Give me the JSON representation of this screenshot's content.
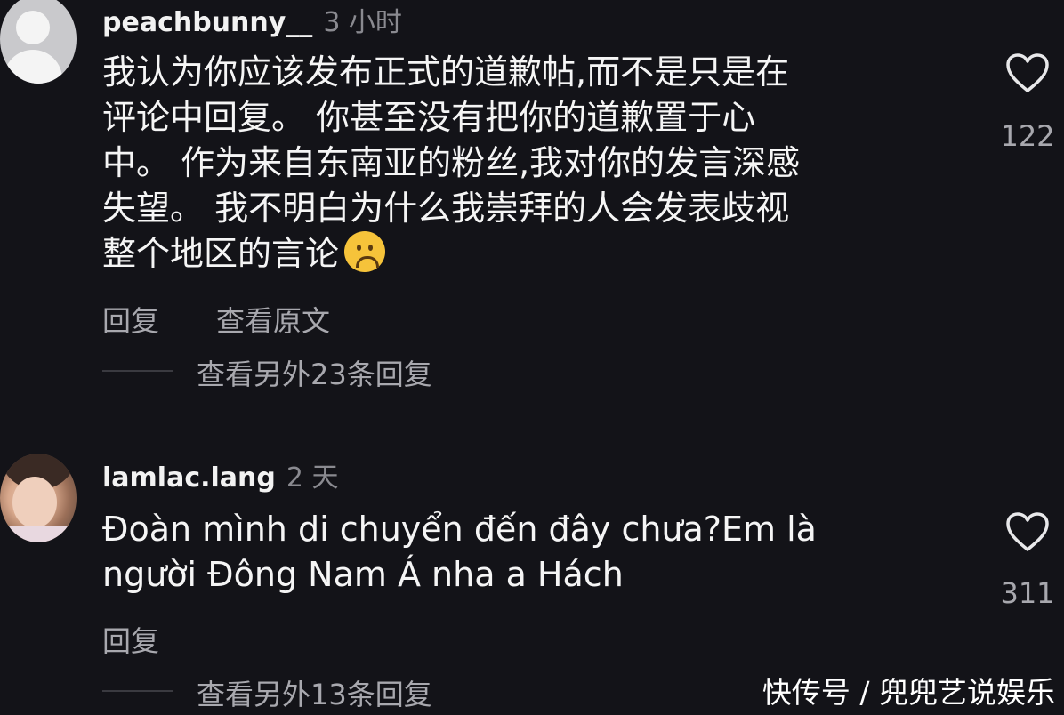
{
  "comments": [
    {
      "username": "peachbunny__",
      "time": "3 小时",
      "text_lines": [
        "我认为你应该发布正式的道歉帖,而不是只是在",
        "评论中回复。 你甚至没有把你的道歉置于心",
        "中。 作为来自东南亚的粉丝,我对你的发言深感",
        "失望。 我不明白为什么我崇拜的人会发表歧视",
        "整个地区的言论"
      ],
      "emoji": "sad-face",
      "reply_label": "回复",
      "translate_label": "查看原文",
      "view_replies": "查看另外23条回复",
      "likes": "122"
    },
    {
      "username": "lamlac.lang",
      "time": "2 天",
      "text_lines": [
        "Đoàn mình di chuyển đến đây chưa?Em là",
        "người Đông Nam Á nha a Hách"
      ],
      "reply_label": "回复",
      "view_replies": "查看另外13条回复",
      "likes": "311"
    }
  ],
  "watermark": "快传号 / 兜兜艺说娱乐",
  "colors": {
    "background": "#131318",
    "text": "#f5f5f5",
    "muted": "#a8a8ae"
  }
}
